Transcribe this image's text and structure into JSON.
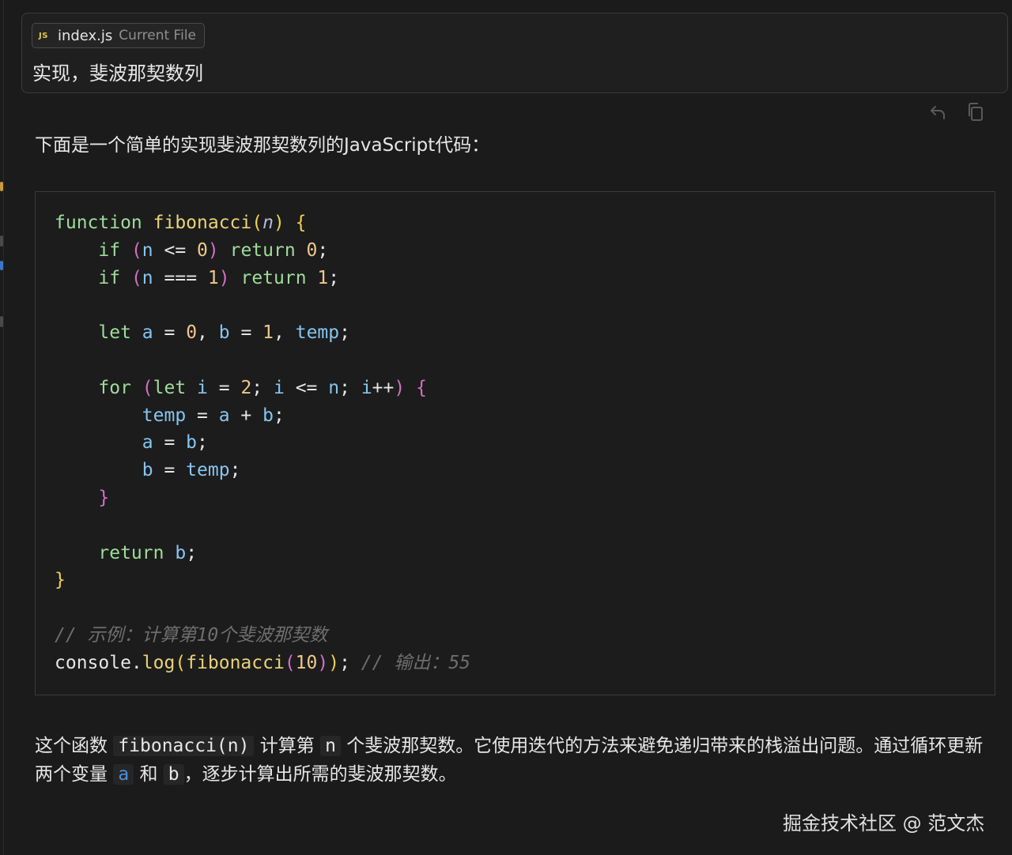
{
  "prompt": {
    "file_chip": {
      "icon": "JS",
      "file_name": "index.js",
      "tag": "Current File"
    },
    "text": "实现，斐波那契数列"
  },
  "toolbar": {
    "icons": [
      "undo-icon",
      "copy-icon"
    ]
  },
  "response": {
    "intro": "下面是一个简单的实现斐波那契数列的JavaScript代码：",
    "code": {
      "language": "javascript",
      "lines": [
        "function fibonacci(n) {",
        "    if (n <= 0) return 0;",
        "    if (n === 1) return 1;",
        "",
        "    let a = 0, b = 1, temp;",
        "",
        "    for (let i = 2; i <= n; i++) {",
        "        temp = a + b;",
        "        a = b;",
        "        b = temp;",
        "    }",
        "",
        "    return b;",
        "}",
        "",
        "// 示例：计算第10个斐波那契数",
        "console.log(fibonacci(10)); // 输出：55"
      ]
    },
    "explanation": {
      "part1": "这个函数",
      "code1": "fibonacci(n)",
      "part2": "计算第",
      "code2": "n",
      "part3": "个斐波那契数。它使用迭代的方法来避免递归带来的栈溢出问题。通过循环更新两个变量",
      "code3": "a",
      "part4": "和",
      "code4": "b",
      "part5": "，逐步计算出所需的斐波那契数。"
    }
  },
  "watermark": "掘金技术社区 @ 范文杰",
  "colors": {
    "background": "#1b1b1b",
    "keyword": "#9fdc9a",
    "function": "#e8d27a",
    "variable": "#86c5f2",
    "number": "#eec88b",
    "comment": "#6e6e6e",
    "inline_var": "#4a8fdc"
  }
}
